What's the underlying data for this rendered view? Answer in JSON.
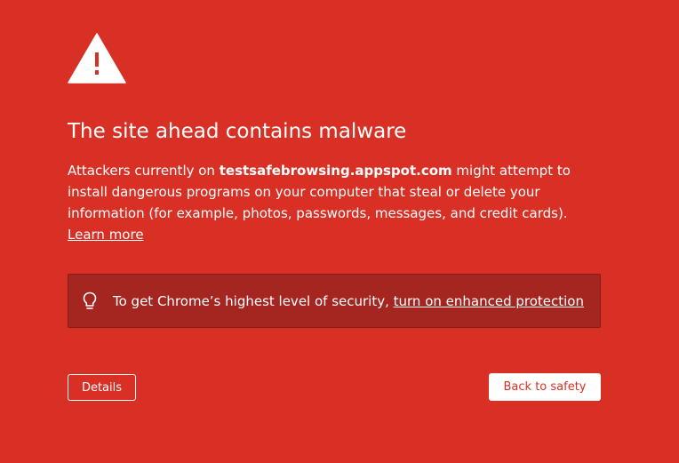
{
  "colors": {
    "background": "#d93025",
    "notice_background": "#a52520",
    "text": "#ffffff",
    "primary_button_text": "#d93025"
  },
  "icons": {
    "warning": "warning-triangle-icon",
    "notice": "lightbulb-icon"
  },
  "interstitial": {
    "heading": "The site ahead contains malware",
    "explanation_prefix": "Attackers currently on ",
    "site": "testsafebrowsing.appspot.com",
    "explanation_suffix": " might attempt to install dangerous programs on your computer that steal or delete your information (for example, photos, passwords, messages, and credit cards). ",
    "learn_more": "Learn more"
  },
  "enhanced_protection": {
    "text": "To get Chrome’s highest level of security, ",
    "link": "turn on enhanced protection"
  },
  "buttons": {
    "details": "Details",
    "back_to_safety": "Back to safety"
  }
}
